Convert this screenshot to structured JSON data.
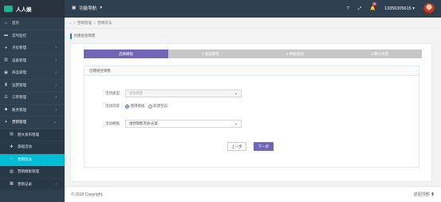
{
  "app": {
    "name": "人人娱"
  },
  "topbar": {
    "func_nav": "功能导航",
    "notif_count": "1",
    "username": "13356305615"
  },
  "sidebar": {
    "items": [
      {
        "label": "首页",
        "icon": "home-icon",
        "glyph": "⌂",
        "has_arrow": false
      },
      {
        "label": "实时监控",
        "icon": "monitor-icon",
        "glyph": "▬",
        "has_arrow": false
      },
      {
        "label": "点位管理",
        "icon": "pin-icon",
        "glyph": "●",
        "has_arrow": true
      },
      {
        "label": "设备管理",
        "icon": "device-icon",
        "glyph": "▥",
        "has_arrow": true
      },
      {
        "label": "商品管理",
        "icon": "goods-icon",
        "glyph": "▣",
        "has_arrow": true
      },
      {
        "label": "运营管理",
        "icon": "ops-icon",
        "glyph": "▮",
        "has_arrow": true
      },
      {
        "label": "订单管理",
        "icon": "order-icon",
        "glyph": "☰",
        "has_arrow": true
      },
      {
        "label": "账务管理",
        "icon": "finance-icon",
        "glyph": "◆",
        "has_arrow": true
      },
      {
        "label": "营销管理",
        "icon": "marketing-icon",
        "glyph": "✦",
        "has_arrow": true,
        "open": true
      },
      {
        "label": "图文发布管理",
        "icon": "publish-icon",
        "glyph": "▤",
        "sub": true
      },
      {
        "label": "基础活动",
        "icon": "activity-icon",
        "glyph": "✚",
        "sub": true
      },
      {
        "label": "营销玩法",
        "icon": "play-icon",
        "glyph": "▭",
        "sub": true,
        "active": true
      },
      {
        "label": "营销模板管理",
        "icon": "template-icon",
        "glyph": "▧",
        "sub": true
      },
      {
        "label": "营销记录",
        "icon": "record-icon",
        "glyph": "▦",
        "sub": true,
        "has_arrow": true
      }
    ]
  },
  "breadcrumb": {
    "home_icon": "home-icon",
    "level1": "营销管理",
    "sep": "/",
    "level2": "营销玩法"
  },
  "page": {
    "title": "创建组合销售"
  },
  "steps": [
    "选择模板",
    "1.基础属性",
    "2.种植规则",
    "3.确认创建"
  ],
  "panel": {
    "title": "创建组合销售",
    "type_label": "活动类型",
    "type_value": "组合销售",
    "content_label": "活动内容",
    "radio_template": "使用模板",
    "radio_new": "新建空白",
    "template_label": "活动模板",
    "template_value": "组合销售活动-方案"
  },
  "buttons": {
    "prev": "上一步",
    "next": "下一步"
  },
  "footer": {
    "copyright": "© 2018 Copyright.",
    "back_top": "返回顶部"
  },
  "colors": {
    "sidebar": "#2f4050",
    "active": "#00bcd4",
    "accent": "#6f67b4"
  }
}
